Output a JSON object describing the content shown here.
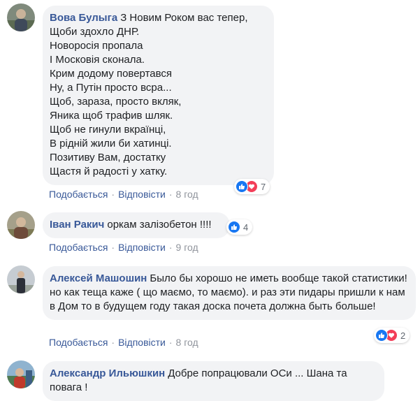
{
  "comments": [
    {
      "author": "Вова Булыга",
      "text": "З Новим Роком вас тепер,\nЩоби здохло ДНР.\nНоворосія пропала\nІ Московія сконала.\nКрим додому повертався\nНу, а Путін просто всра...\nЩоб, зараза, просто вкляк,\nЯника щоб трафив шляк.\nЩоб не гинули вкраїнці,\nВ рідній жили би хатинці.\nПозитиву Вам, достатку\nЩастя й радості у хатку.",
      "reaction_count": "7",
      "like_label": "Подобається",
      "reply_label": "Відповісти",
      "time": "8 год"
    },
    {
      "author": "Іван Ракич",
      "text": "оркам залізобетон !!!!",
      "reaction_count": "4",
      "like_label": "Подобається",
      "reply_label": "Відповісти",
      "time": "9 год"
    },
    {
      "author": "Алексей Машошин",
      "text": "Было бы хорошо не иметь вообще такой статистики! но как теща каже ( що маємо, то маємо). и раз эти пидары пришли к нам в Дом то в будущем году такая доска почета должна быть больше!",
      "reaction_count": "2",
      "like_label": "Подобається",
      "reply_label": "Відповісти",
      "time": "8 год"
    },
    {
      "author": "Александр Ильюшкин",
      "text": "Добре попрацювали ОСи ... Шана та повага !"
    }
  ],
  "separator": "·",
  "colors": {
    "link": "#385898",
    "bubble": "#f2f3f5",
    "like": "#1877f2",
    "love": "#f33e58",
    "meta": "#90949c"
  }
}
